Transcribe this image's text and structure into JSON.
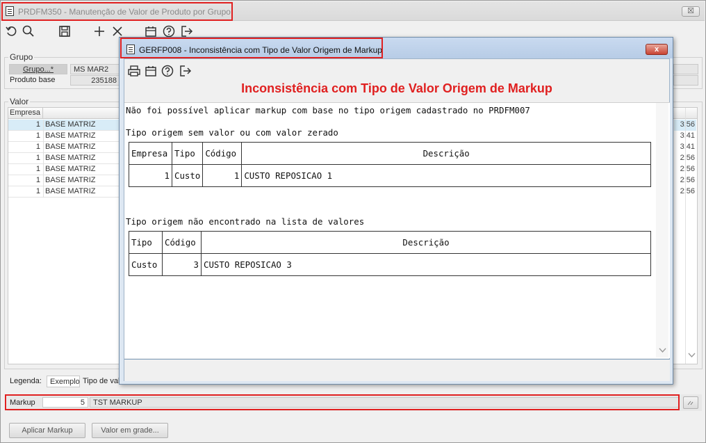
{
  "main_window": {
    "title": "PRDFM350 - Manutenção de Valor de Produto por Grupo",
    "close_glyph": "☒"
  },
  "toolbar": {
    "icons": [
      "undo-icon",
      "search-icon",
      "save-icon",
      "add-icon",
      "close-icon",
      "calendar-icon",
      "help-icon",
      "exit-icon"
    ]
  },
  "grupo": {
    "legend": "Grupo",
    "grupo_button": "Grupo...*",
    "grupo_value": "MS MAR2",
    "produto_base_label": "Produto base",
    "produto_base_value": "235188"
  },
  "valor": {
    "legend": "Valor",
    "col_empresa": "Empresa",
    "rows": [
      {
        "empresa": "1",
        "nome": "BASE MATRIZ",
        "time": "3:56",
        "selected": true
      },
      {
        "empresa": "1",
        "nome": "BASE MATRIZ",
        "time": "3:41",
        "selected": false
      },
      {
        "empresa": "1",
        "nome": "BASE MATRIZ",
        "time": "3:41",
        "selected": false
      },
      {
        "empresa": "1",
        "nome": "BASE MATRIZ",
        "time": "2:56",
        "selected": false
      },
      {
        "empresa": "1",
        "nome": "BASE MATRIZ",
        "time": "2:56",
        "selected": false
      },
      {
        "empresa": "1",
        "nome": "BASE MATRIZ",
        "time": "2:56",
        "selected": false
      },
      {
        "empresa": "1",
        "nome": "BASE MATRIZ",
        "time": "2:56",
        "selected": false
      }
    ]
  },
  "legenda": {
    "label": "Legenda:",
    "exemplo": "Exemplo",
    "tipo": "Tipo de val"
  },
  "markup": {
    "label": "Markup",
    "value": "5",
    "desc": "TST MARKUP"
  },
  "buttons": {
    "aplicar": "Aplicar Markup",
    "valor_grade": "Valor em grade..."
  },
  "dialog": {
    "title": "GERFP008 - Inconsistência com Tipo de Valor Origem de Markup",
    "close_glyph": "x",
    "heading": "Inconsistência com Tipo de Valor Origem de Markup",
    "toolbar_icons": [
      "print-icon",
      "calendar-icon",
      "help-icon",
      "exit-icon"
    ],
    "line1": "Não foi possível aplicar markup com base no tipo origem cadastrado no PRDFM007",
    "section1": "Tipo origem sem valor ou com valor zerado",
    "table1": {
      "headers": [
        "Empresa",
        "Tipo",
        "Código",
        "Descrição"
      ],
      "row": [
        "1",
        "Custo",
        "1",
        "CUSTO REPOSICAO 1"
      ]
    },
    "section2": "Tipo origem não encontrado na lista de valores",
    "table2": {
      "headers": [
        "Tipo",
        "Código",
        "Descrição"
      ],
      "row": [
        "Custo",
        "3",
        "CUSTO REPOSICAO 3"
      ]
    }
  },
  "colors": {
    "highlight_red": "#e02020",
    "selection": "#d8ecf7",
    "dialog_frame": "#c9daf0"
  }
}
